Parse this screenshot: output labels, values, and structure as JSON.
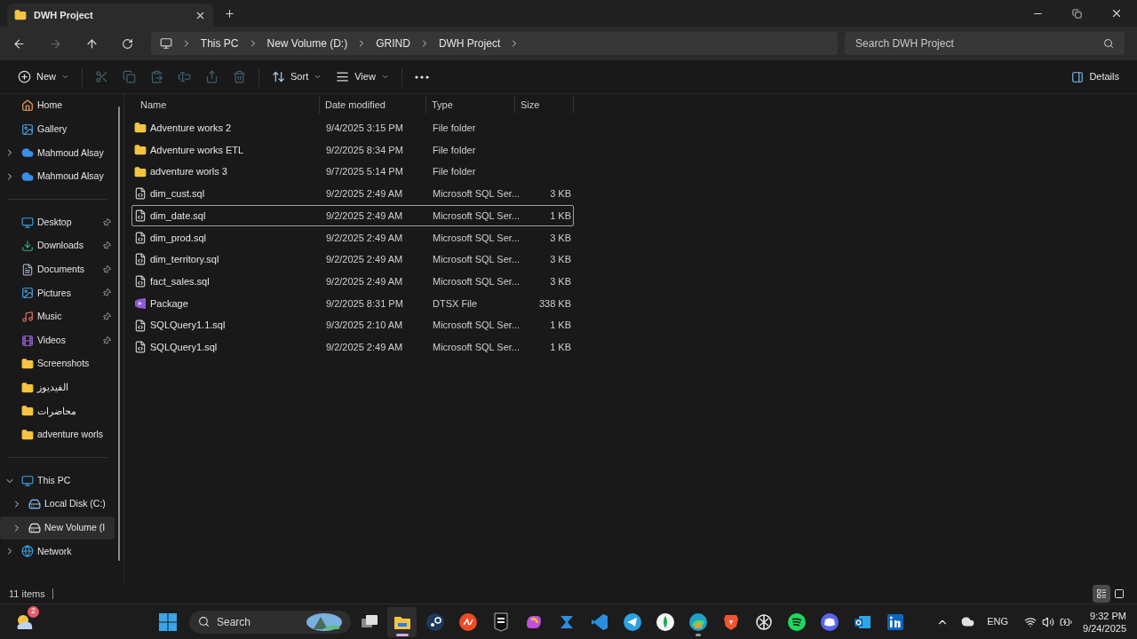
{
  "window": {
    "tab_title": "DWH Project"
  },
  "address": {
    "crumbs": [
      "This PC",
      "New Volume (D:)",
      "GRIND",
      "DWH Project"
    ],
    "search_placeholder": "Search DWH Project"
  },
  "toolbar": {
    "items": [
      {
        "kind": "new",
        "label": "New",
        "disabled": false
      },
      {
        "kind": "cut",
        "disabled": true
      },
      {
        "kind": "copy",
        "disabled": true
      },
      {
        "kind": "paste",
        "disabled": true
      },
      {
        "kind": "rename",
        "disabled": true
      },
      {
        "kind": "share",
        "disabled": true
      },
      {
        "kind": "delete",
        "disabled": true
      },
      {
        "kind": "sort",
        "label": "Sort",
        "disabled": false
      },
      {
        "kind": "view",
        "label": "View",
        "disabled": false
      },
      {
        "kind": "more",
        "disabled": false
      }
    ],
    "details_label": "Details"
  },
  "sidebar": {
    "groups": [
      [
        {
          "kind": "home",
          "label": "Home"
        },
        {
          "kind": "gallery",
          "label": "Gallery"
        },
        {
          "kind": "cloud",
          "label": "Mahmoud Alsay",
          "expanded": false
        },
        {
          "kind": "cloud",
          "label": "Mahmoud Alsay",
          "expanded": false
        }
      ],
      [
        {
          "kind": "desktop",
          "label": "Desktop",
          "pinned": true
        },
        {
          "kind": "downloads",
          "label": "Downloads",
          "pinned": true
        },
        {
          "kind": "documents",
          "label": "Documents",
          "pinned": true
        },
        {
          "kind": "pictures",
          "label": "Pictures",
          "pinned": true
        },
        {
          "kind": "music",
          "label": "Music",
          "pinned": true
        },
        {
          "kind": "videos",
          "label": "Videos",
          "pinned": true
        },
        {
          "kind": "folder",
          "label": "Screenshots",
          "pinned": false
        },
        {
          "kind": "folder",
          "label": "الفيديوز",
          "pinned": false
        },
        {
          "kind": "folder",
          "label": "محاضرات",
          "pinned": false
        },
        {
          "kind": "folder",
          "label": "adventure worls",
          "pinned": false
        }
      ],
      [
        {
          "kind": "pc",
          "label": "This PC",
          "expanded": true,
          "selected": false,
          "children": [
            {
              "kind": "disk",
              "label": "Local Disk (C:)",
              "expanded": false,
              "selected": false
            },
            {
              "kind": "drive",
              "label": "New Volume (I",
              "expanded": false,
              "selected": true
            }
          ]
        },
        {
          "kind": "network",
          "label": "Network",
          "expanded": false,
          "selected": false
        }
      ]
    ]
  },
  "table": {
    "columns": [
      "Name",
      "Date modified",
      "Type",
      "Size"
    ],
    "rows": [
      {
        "kind": "folder",
        "name": "Adventure works 2",
        "date": "9/4/2025 3:15 PM",
        "type": "File folder",
        "selected": false
      },
      {
        "kind": "folder",
        "name": "Adventure works ETL",
        "date": "9/2/2025 8:34 PM",
        "type": "File folder",
        "selected": false
      },
      {
        "kind": "folder",
        "name": "adventure worls 3",
        "date": "9/7/2025 5:14 PM",
        "type": "File folder",
        "selected": false
      },
      {
        "kind": "sql",
        "name": "dim_cust.sql",
        "date": "9/2/2025 2:49 AM",
        "type": "Microsoft SQL Ser...",
        "size": "3 KB",
        "selected": false
      },
      {
        "kind": "sql",
        "name": "dim_date.sql",
        "date": "9/2/2025 2:49 AM",
        "type": "Microsoft SQL Ser...",
        "size": "1 KB",
        "selected": true
      },
      {
        "kind": "sql",
        "name": "dim_prod.sql",
        "date": "9/2/2025 2:49 AM",
        "type": "Microsoft SQL Ser...",
        "size": "3 KB",
        "selected": false
      },
      {
        "kind": "sql",
        "name": "dim_territory.sql",
        "date": "9/2/2025 2:49 AM",
        "type": "Microsoft SQL Ser...",
        "size": "3 KB",
        "selected": false
      },
      {
        "kind": "sql",
        "name": "fact_sales.sql",
        "date": "9/2/2025 2:49 AM",
        "type": "Microsoft SQL Ser...",
        "size": "3 KB",
        "selected": false
      },
      {
        "kind": "dtsx",
        "name": "Package",
        "date": "9/2/2025 8:31 PM",
        "type": "DTSX File",
        "size": "338 KB",
        "selected": false
      },
      {
        "kind": "sql",
        "name": "SQLQuery1.1.sql",
        "date": "9/3/2025 2:10 AM",
        "type": "Microsoft SQL Ser...",
        "size": "1 KB",
        "selected": false
      },
      {
        "kind": "sql",
        "name": "SQLQuery1.sql",
        "date": "9/2/2025 2:49 AM",
        "type": "Microsoft SQL Ser...",
        "size": "1 KB",
        "selected": false
      }
    ]
  },
  "status_bar": {
    "count": "11 items",
    "views": [
      {
        "kind": "details",
        "selected": true
      },
      {
        "kind": "tiles",
        "selected": false
      }
    ]
  },
  "taskbar": {
    "weather_badge": "2",
    "search_placeholder": "Search",
    "apps": [
      {
        "kind": "taskview",
        "selected": false,
        "running": false
      },
      {
        "kind": "explorer",
        "selected": true,
        "running": true
      },
      {
        "kind": "steam",
        "selected": false,
        "running": false
      },
      {
        "kind": "ea",
        "selected": false,
        "running": false
      },
      {
        "kind": "epic",
        "selected": false,
        "running": false
      },
      {
        "kind": "copilot",
        "selected": false,
        "running": false
      },
      {
        "kind": "azure",
        "selected": false,
        "running": false
      },
      {
        "kind": "vscode",
        "selected": false,
        "running": false
      },
      {
        "kind": "telegram",
        "selected": false,
        "running": false
      },
      {
        "kind": "leaf",
        "selected": false,
        "running": false
      },
      {
        "kind": "edge",
        "selected": false,
        "running": true
      },
      {
        "kind": "brave",
        "selected": false,
        "running": false
      },
      {
        "kind": "knot",
        "selected": false,
        "running": false
      },
      {
        "kind": "spotify",
        "selected": false,
        "running": false
      },
      {
        "kind": "discord",
        "selected": false,
        "running": false
      },
      {
        "kind": "outlook",
        "selected": false,
        "running": false
      },
      {
        "kind": "linkedin",
        "selected": false,
        "running": false
      }
    ],
    "language": "ENG",
    "time": "9:32 PM",
    "date": "9/24/2025"
  }
}
